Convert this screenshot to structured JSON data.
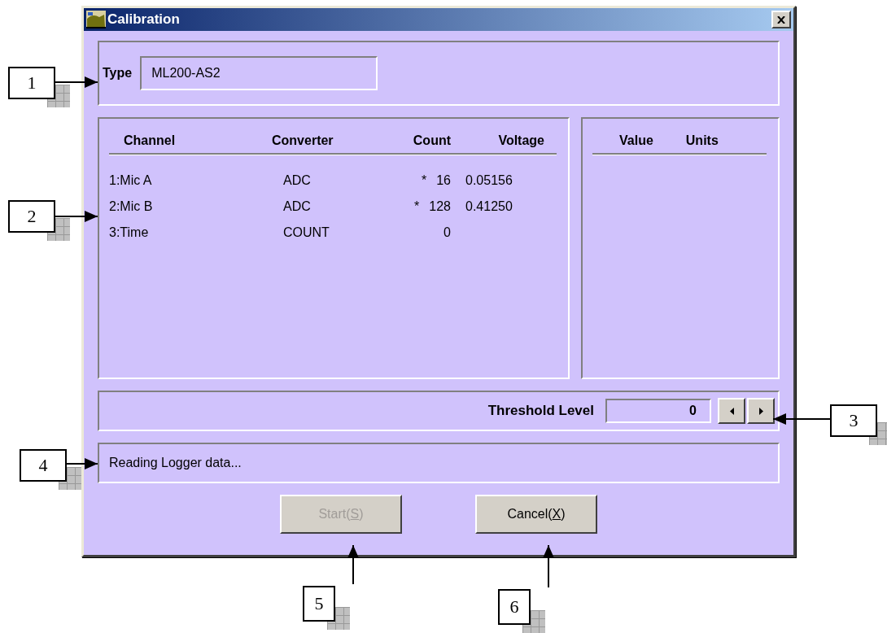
{
  "window": {
    "title": "Calibration"
  },
  "type": {
    "label": "Type",
    "value": "ML200-AS2"
  },
  "channels": {
    "columns": [
      "Channel",
      "Converter",
      "Count",
      "Voltage"
    ],
    "rows": [
      {
        "channel": "1:Mic A",
        "converter": "ADC",
        "flag": "*",
        "count": "16",
        "voltage": "0.05156"
      },
      {
        "channel": "2:Mic B",
        "converter": "ADC",
        "flag": "*",
        "count": "128",
        "voltage": "0.41250"
      },
      {
        "channel": "3:Time",
        "converter": "COUNT",
        "count": "0"
      }
    ]
  },
  "values": {
    "columns": [
      "Value",
      "Units"
    ]
  },
  "threshold": {
    "label": "Threshold Level",
    "value": "0"
  },
  "status": "Reading Logger data...",
  "buttons": [
    {
      "before": "Start(",
      "mnemonic": "S",
      "after": ")",
      "disabled": true
    },
    {
      "before": "Cancel(",
      "mnemonic": "X",
      "after": ")",
      "disabled": false
    }
  ],
  "callouts": [
    {
      "label": "1"
    },
    {
      "label": "2"
    },
    {
      "label": "3"
    },
    {
      "label": "4"
    },
    {
      "label": "5"
    },
    {
      "label": "6"
    }
  ]
}
